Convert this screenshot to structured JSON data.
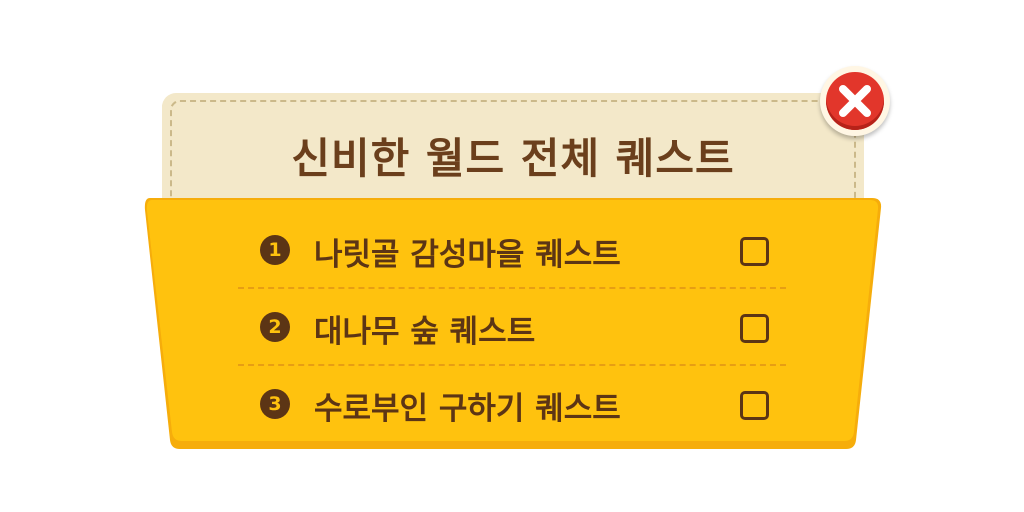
{
  "dialog": {
    "title": "신비한 월드 전체 퀘스트",
    "close_icon": "close-icon"
  },
  "quests": [
    {
      "number": "1",
      "label": "나릿골 감성마을 퀘스트",
      "checked": false
    },
    {
      "number": "2",
      "label": "대나무 숲 퀘스트",
      "checked": false
    },
    {
      "number": "3",
      "label": "수로부인 구하기 퀘스트",
      "checked": false
    }
  ],
  "colors": {
    "title_card": "#f3e8c9",
    "panel": "#ffc20e",
    "panel_edge": "#f6ad0b",
    "text": "#5c3515",
    "close": "#e2362b"
  }
}
